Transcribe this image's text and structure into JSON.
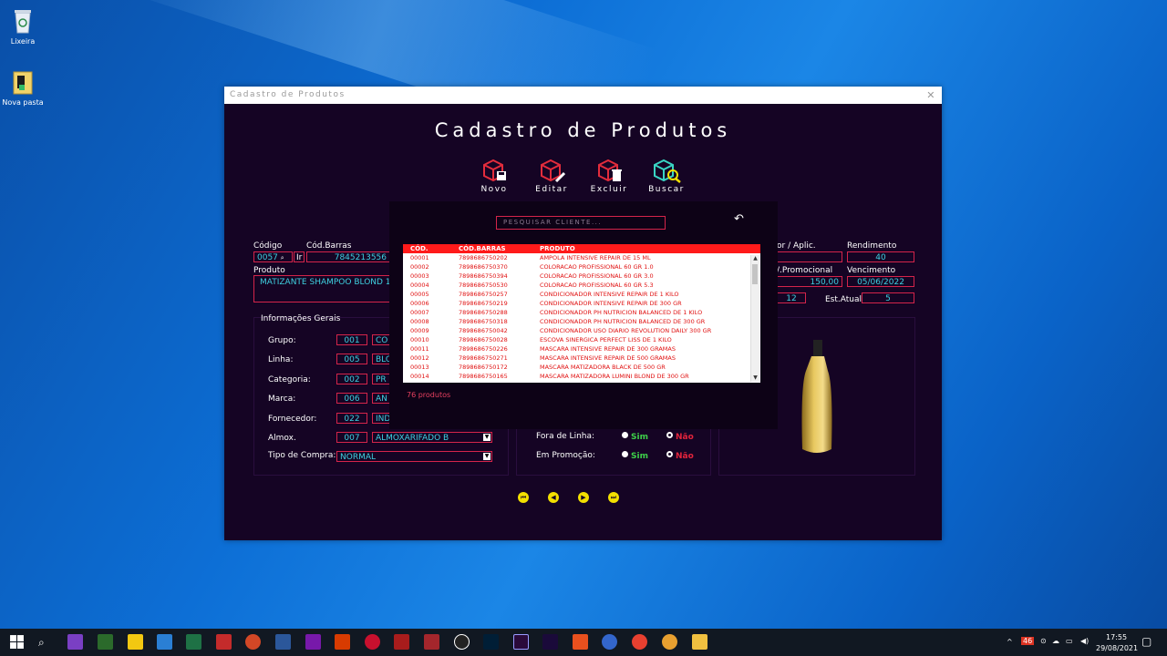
{
  "desktop": {
    "icons": [
      {
        "label": "Lixeira"
      },
      {
        "label": "Nova pasta"
      }
    ]
  },
  "window": {
    "titlebar": "Cadastro de Produtos",
    "title": "Cadastro de Produtos",
    "toolbar": {
      "novo": "Novo",
      "editar": "Editar",
      "excluir": "Excluir",
      "buscar": "Buscar"
    },
    "form": {
      "codigo_label": "Código",
      "codigo_value": "0057",
      "ir_label": "Ir",
      "codbarras_label": "Cód.Barras",
      "codbarras_value": "7845213556",
      "produto_label": "Produto",
      "produto_value": "MATIZANTE SHAMPOO BLOND 1",
      "valor_aplic_label": "or / Aplic.",
      "rendimento_label": "Rendimento",
      "rendimento_value": "40",
      "v_promocional_label": "/.Promocional",
      "v_promocional_value": "150,00",
      "vencimento_label": "Vencimento",
      "vencimento_value": "05/06/2022",
      "est_min_value": "12",
      "est_atual_label": "Est.Atual",
      "est_atual_value": "5",
      "info_title": "Informações Gerais",
      "grupo_label": "Grupo:",
      "grupo_code": "001",
      "grupo_value": "CO",
      "linha_label": "Linha:",
      "linha_code": "005",
      "linha_value": "BLO",
      "categoria_label": "Categoria:",
      "categoria_code": "002",
      "categoria_value": "PR",
      "marca_label": "Marca:",
      "marca_code": "006",
      "marca_value": "AN",
      "fornecedor_label": "Fornecedor:",
      "fornecedor_code": "022",
      "fornecedor_value": "IND",
      "almox_label": "Almox.",
      "almox_code": "007",
      "almox_value": "ALMOXARIFADO B",
      "tipo_compra_label": "Tipo de Compra:",
      "tipo_compra_value": "NORMAL",
      "fora_linha_label": "Fora de Linha:",
      "em_promocao_label": "Em Promoção:",
      "sim": "Sim",
      "nao": "Não"
    }
  },
  "popup": {
    "search_placeholder": "PESQUISAR CLIENTE...",
    "columns": [
      "CÓD.",
      "CÓD.BARRAS",
      "PRODUTO"
    ],
    "rows": [
      [
        "00001",
        "7898686750202",
        "AMPOLA INTENSIVE REPAIR DE 15 ML"
      ],
      [
        "00002",
        "7898686750370",
        "COLORACAO PROFISSIONAL 60 GR 1.0"
      ],
      [
        "00003",
        "7898686750394",
        "COLORACAO PROFISSIONAL 60 GR 3.0"
      ],
      [
        "00004",
        "7898686750530",
        "COLORACAO PROFISSIONAL 60 GR 5.3"
      ],
      [
        "00005",
        "7898686750257",
        "CONDICIONADOR INTENSIVE REPAIR DE 1 KILO"
      ],
      [
        "00006",
        "7898686750219",
        "CONDICIONADOR INTENSIVE REPAIR DE 300 GR"
      ],
      [
        "00007",
        "7898686750288",
        "CONDICIONADOR PH NUTRICION BALANCED DE 1 KILO"
      ],
      [
        "00008",
        "7898686750318",
        "CONDICIONADOR PH NUTRICION BALANCED DE 300 GR"
      ],
      [
        "00009",
        "7898686750042",
        "CONDICIONADOR USO DIARIO REVOLUTION DAILY 300 GR"
      ],
      [
        "00010",
        "7898686750028",
        "ESCOVA SINERGICA PERFECT LISS DE 1 KILO"
      ],
      [
        "00011",
        "7898686750226",
        "MASCARA INTENSIVE REPAIR DE 300 GRAMAS"
      ],
      [
        "00012",
        "7898686750271",
        "MASCARA INTENSIVE REPAIR DE 500 GRAMAS"
      ],
      [
        "00013",
        "7898686750172",
        "MASCARA MATIZADORA BLACK DE 500 GR"
      ],
      [
        "00014",
        "7898686750165",
        "MASCARA MATIZADORA LUMINI BLOND DE 300 GR"
      ]
    ],
    "count": "76 produtos"
  },
  "taskbar": {
    "time": "17:55",
    "date": "29/08/2021",
    "badge": "46"
  },
  "colors": {
    "accent": "#d4244a",
    "field_text": "#3ed1e0",
    "window_bg": "#150424"
  }
}
